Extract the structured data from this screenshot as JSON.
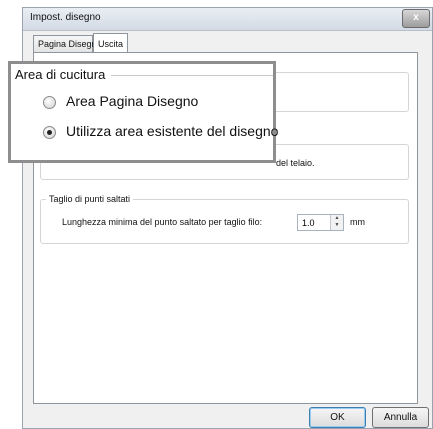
{
  "window": {
    "title": "Impost. disegno",
    "close_glyph": "x"
  },
  "tabs": [
    {
      "label": "Pagina Disegno",
      "active": false
    },
    {
      "label": "Uscita",
      "active": true
    }
  ],
  "frame_note": "del telaio.",
  "jump_cut": {
    "group_title": "Taglio di punti saltati",
    "field_label": "Lunghezza minima del punto saltato per taglio filo:",
    "value": "1.0",
    "unit": "mm"
  },
  "sewing_area": {
    "title": "Area di cucitura",
    "options": [
      {
        "label": "Area Pagina Disegno",
        "selected": false
      },
      {
        "label": "Utilizza area esistente del disegno",
        "selected": true
      }
    ]
  },
  "buttons": {
    "ok": "OK",
    "cancel": "Annulla"
  }
}
